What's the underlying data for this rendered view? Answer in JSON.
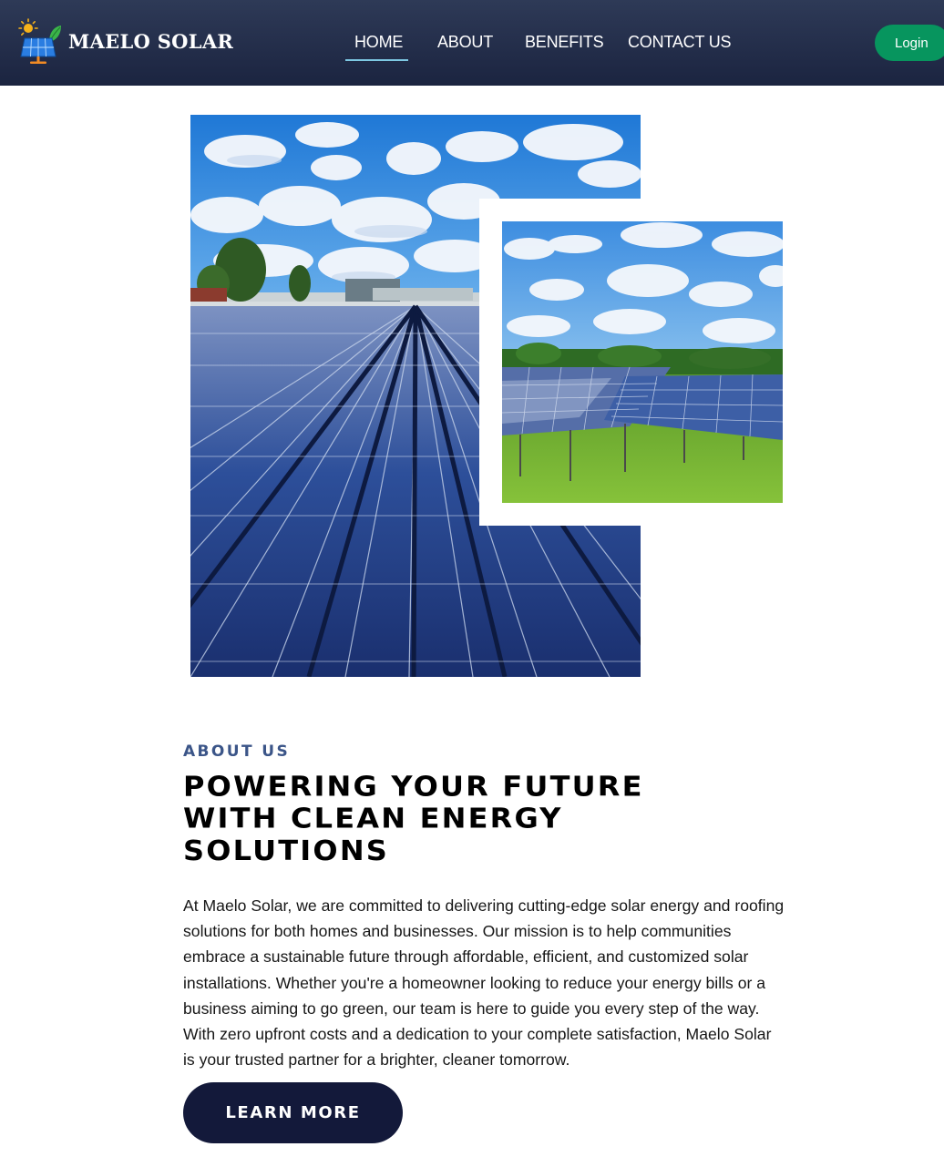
{
  "brand": {
    "name": "MAELO SOLAR",
    "logo_icon": "solar-panel-with-sun-and-leaf-icon"
  },
  "nav": {
    "links": [
      {
        "label": "HOME",
        "active": true
      },
      {
        "label": "ABOUT",
        "active": false
      },
      {
        "label": "BENEFITS",
        "active": false
      },
      {
        "label": "CONTACT US",
        "active": false
      }
    ],
    "login_label": "Login"
  },
  "about": {
    "eyebrow": "ABOUT US",
    "headline_lines": [
      "POWERING YOUR FUTURE",
      "WITH CLEAN ENERGY",
      "SOLUTIONS"
    ],
    "body_lines": [
      "At Maelo Solar, we are committed to delivering cutting-edge solar energy and roofing",
      "solutions for both homes and businesses. Our mission is to help communities",
      "embrace a sustainable future through affordable, efficient, and customized solar",
      "installations. Whether you're a homeowner looking to reduce your energy bills or a",
      "business aiming to go green, our team is here to guide you every step of the way.",
      "With zero upfront costs and a dedication to your complete satisfaction, Maelo Solar",
      "is your trusted partner for a brighter, cleaner tomorrow."
    ],
    "cta_label": "LEARN MORE"
  },
  "colors": {
    "nav_background": "#1f2945",
    "nav_active_underline": "#7ec8e3",
    "login_button": "#07955e",
    "eyebrow": "#3b5588",
    "cta_button": "#13193a"
  }
}
